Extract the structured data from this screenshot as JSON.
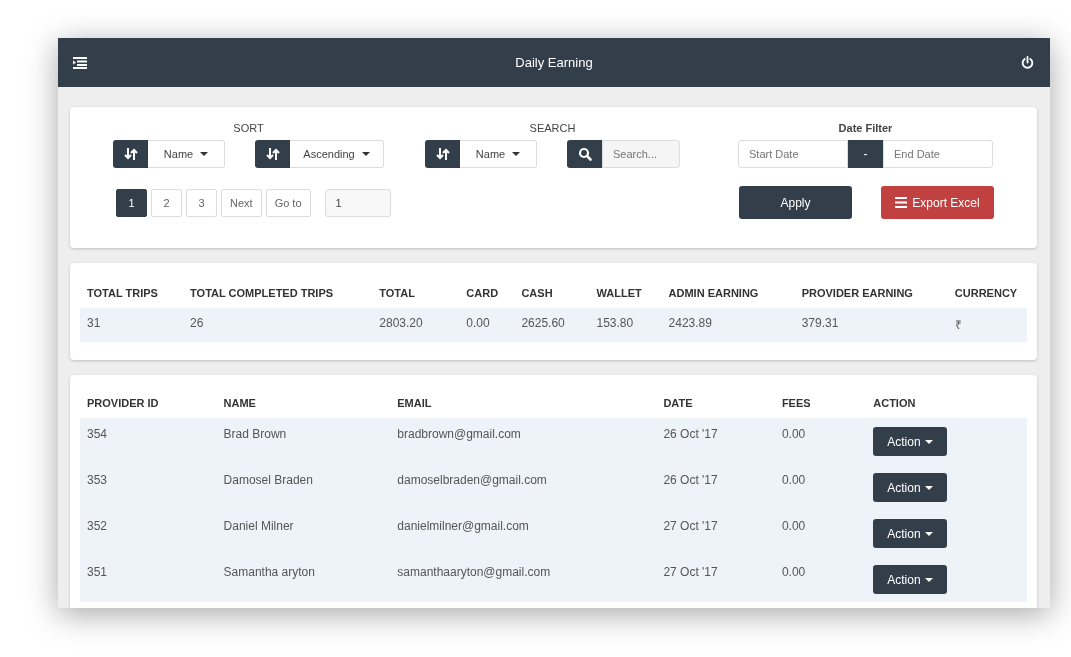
{
  "header": {
    "title": "Daily Earning"
  },
  "filters": {
    "sort_label": "SORT",
    "sort_field": "Name",
    "sort_order": "Ascending",
    "search_label": "SEARCH",
    "search_field": "Name",
    "search_placeholder": "Search...",
    "date_label": "Date Filter",
    "start_placeholder": "Start Date",
    "separator": "-",
    "end_placeholder": "End Date"
  },
  "pagination": {
    "pages": [
      {
        "label": "1",
        "selected": true
      },
      {
        "label": "2",
        "selected": false
      },
      {
        "label": "3",
        "selected": false
      }
    ],
    "next": "Next",
    "goto": "Go to",
    "goto_value": "1"
  },
  "buttons": {
    "apply": "Apply",
    "export": "Export Excel"
  },
  "summary": {
    "columns": [
      "TOTAL TRIPS",
      "TOTAL COMPLETED TRIPS",
      "TOTAL",
      "CARD",
      "CASH",
      "WALLET",
      "ADMIN EARNING",
      "PROVIDER EARNING",
      "CURRENCY"
    ],
    "row": [
      "31",
      "26",
      "2803.20",
      "0.00",
      "2625.60",
      "153.80",
      "2423.89",
      "379.31",
      "₹"
    ]
  },
  "table": {
    "columns": [
      "PROVIDER ID",
      "NAME",
      "EMAIL",
      "DATE",
      "FEES",
      "ACTION"
    ],
    "rows": [
      {
        "id": "354",
        "name": "Brad Brown",
        "email": "bradbrown@gmail.com",
        "date": "26 Oct '17",
        "fees": "0.00",
        "action": "Action"
      },
      {
        "id": "353",
        "name": "Damosel Braden",
        "email": "damoselbraden@gmail.com",
        "date": "26 Oct '17",
        "fees": "0.00",
        "action": "Action"
      },
      {
        "id": "352",
        "name": "Daniel Milner",
        "email": "danielmilner@gmail.com",
        "date": "27 Oct '17",
        "fees": "0.00",
        "action": "Action"
      },
      {
        "id": "351",
        "name": "Samantha aryton",
        "email": "samanthaaryton@gmail.com",
        "date": "27 Oct '17",
        "fees": "0.00",
        "action": "Action"
      }
    ]
  }
}
